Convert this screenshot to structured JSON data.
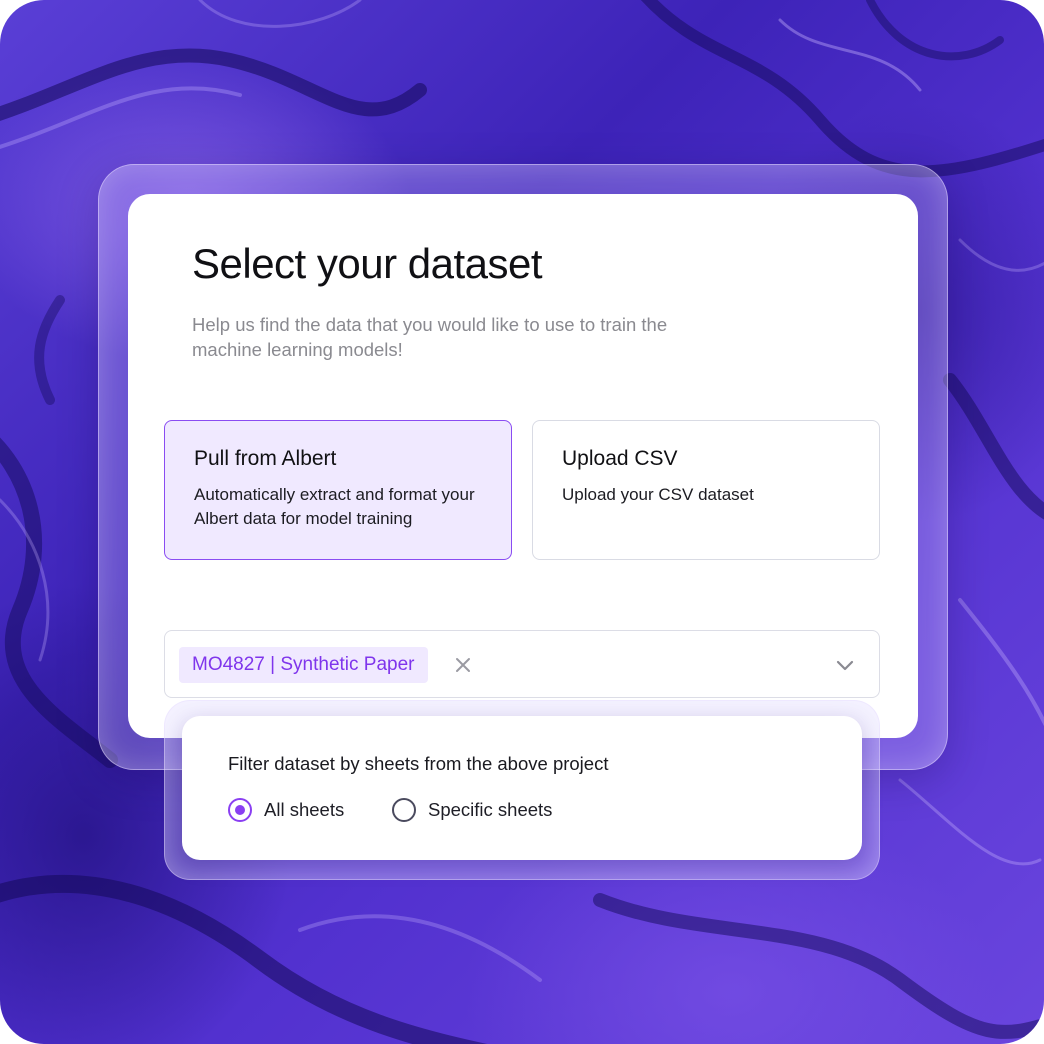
{
  "dialog": {
    "title": "Select your dataset",
    "subtitle": "Help us find the data that you would like to use to train the machine learning models!"
  },
  "options": [
    {
      "title": "Pull from Albert",
      "description": "Automatically extract and format your Albert data for model training",
      "selected": true
    },
    {
      "title": "Upload CSV",
      "description": "Upload your CSV dataset",
      "selected": false
    }
  ],
  "project_select": {
    "selected_chip": "MO4827 | Synthetic Paper",
    "clear_icon": "close-icon",
    "dropdown_icon": "chevron-down-icon"
  },
  "sheet_filter": {
    "label": "Filter dataset by sheets from the above project",
    "choices": [
      {
        "label": "All sheets",
        "checked": true
      },
      {
        "label": "Specific sheets",
        "checked": false
      }
    ]
  },
  "colors": {
    "accent": "#8a3ff2",
    "accent_text": "#7f35ec",
    "selected_bg": "#f0e9ff",
    "background": "#4b2fc9"
  }
}
